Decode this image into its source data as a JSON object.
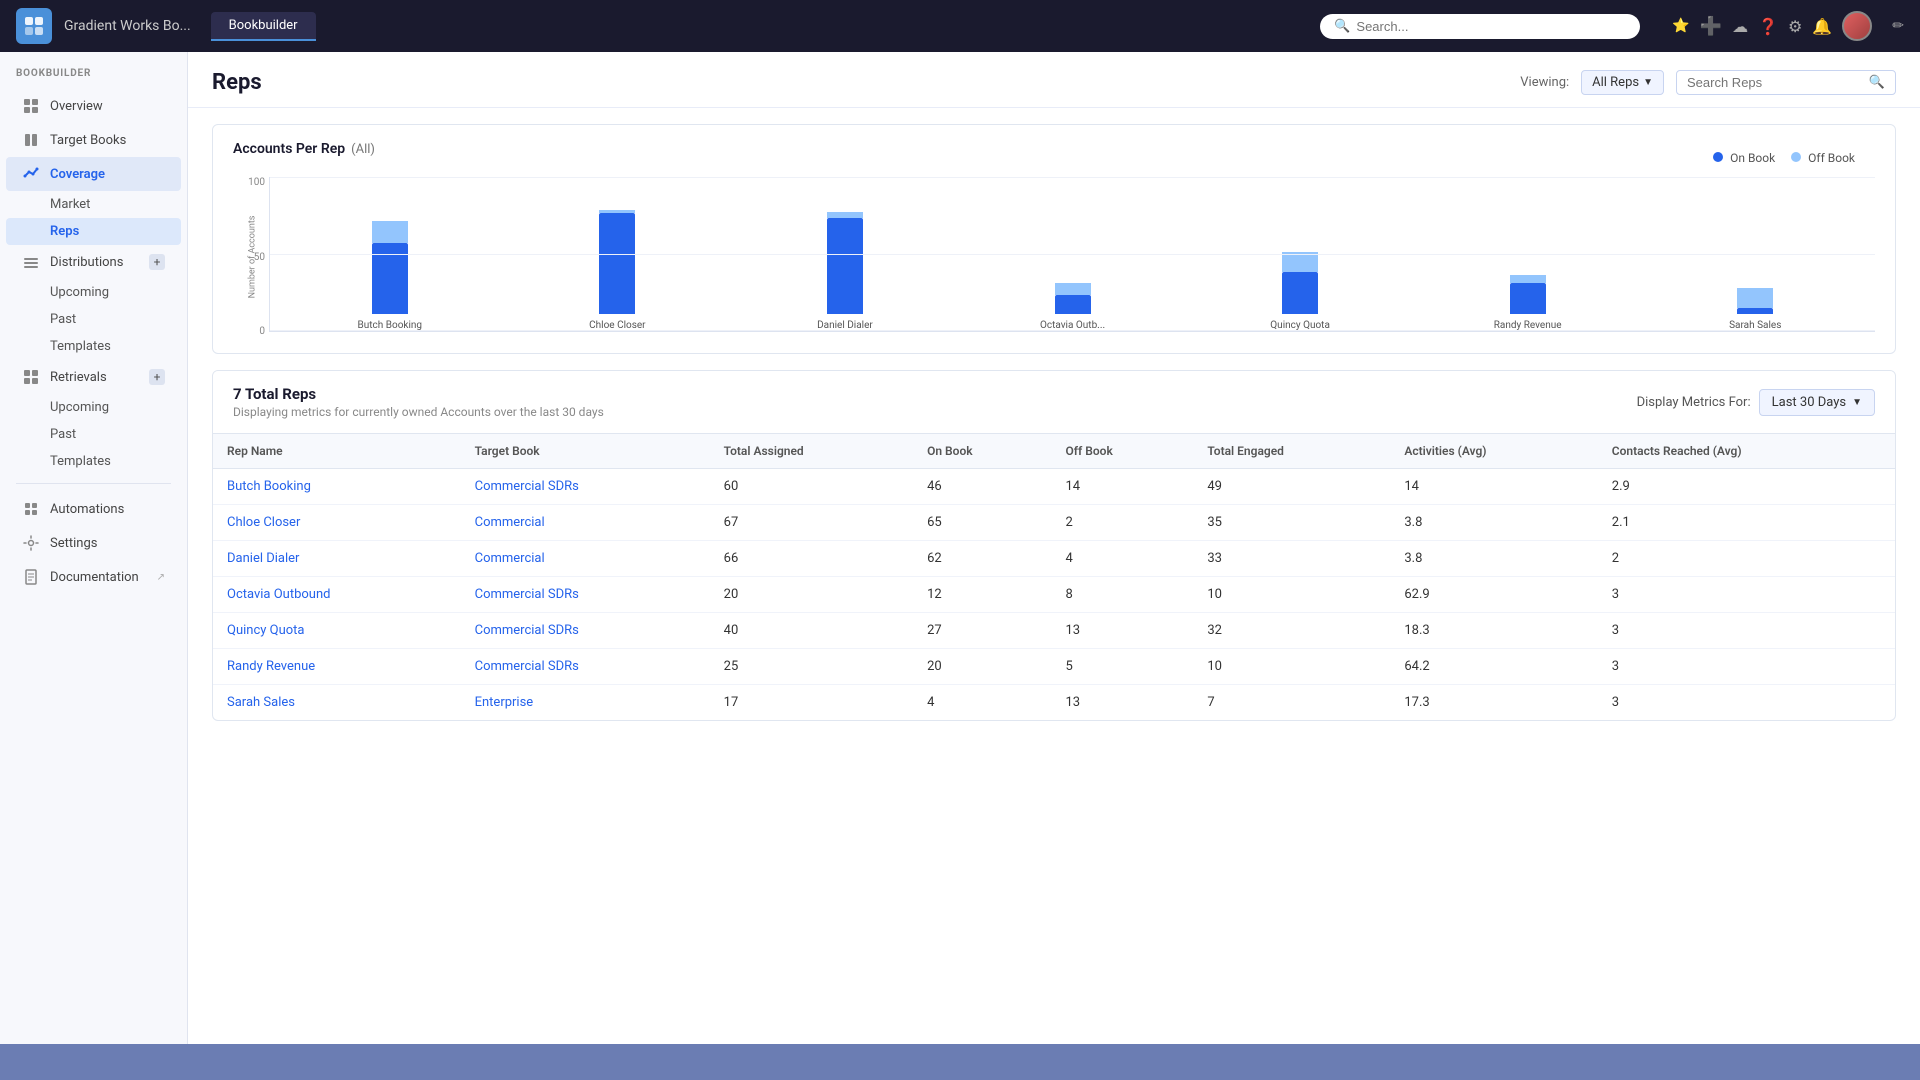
{
  "chrome": {
    "app_name": "Gradient Works Bo...",
    "tab_label": "Bookbuilder",
    "search_placeholder": "Search...",
    "icons": [
      "star-icon",
      "add-icon",
      "cloud-icon",
      "help-icon",
      "settings-icon",
      "notifications-icon"
    ]
  },
  "sidebar": {
    "section_title": "BOOKBUILDER",
    "items": [
      {
        "id": "overview",
        "label": "Overview",
        "icon": "overview-icon"
      },
      {
        "id": "target-books",
        "label": "Target Books",
        "icon": "books-icon"
      },
      {
        "id": "coverage",
        "label": "Coverage",
        "icon": "coverage-icon",
        "active": true,
        "children": [
          {
            "id": "market",
            "label": "Market"
          },
          {
            "id": "reps",
            "label": "Reps",
            "active": true
          }
        ]
      },
      {
        "id": "distributions",
        "label": "Distributions",
        "icon": "distributions-icon",
        "children": [
          {
            "id": "upcoming-dist",
            "label": "Upcoming"
          },
          {
            "id": "past-dist",
            "label": "Past"
          },
          {
            "id": "templates-dist",
            "label": "Templates"
          }
        ]
      },
      {
        "id": "retrievals",
        "label": "Retrievals",
        "icon": "retrievals-icon",
        "children": [
          {
            "id": "upcoming-ret",
            "label": "Upcoming"
          },
          {
            "id": "past-ret",
            "label": "Past"
          },
          {
            "id": "templates-ret",
            "label": "Templates"
          }
        ]
      },
      {
        "id": "automations",
        "label": "Automations",
        "icon": "automations-icon"
      },
      {
        "id": "settings",
        "label": "Settings",
        "icon": "settings-icon"
      },
      {
        "id": "documentation",
        "label": "Documentation",
        "icon": "documentation-icon"
      }
    ]
  },
  "page": {
    "title": "Reps",
    "viewing_label": "Viewing:",
    "viewing_value": "All Reps",
    "search_placeholder": "Search Reps"
  },
  "chart": {
    "title": "Accounts Per Rep",
    "subtitle": "(All)",
    "legend": {
      "on_book": "On Book",
      "off_book": "Off Book"
    },
    "y_axis_label": "Number of Accounts",
    "y_labels": [
      "100",
      "50",
      "0"
    ],
    "bars": [
      {
        "name": "Butch Booking",
        "on_book": 46,
        "off_book": 14,
        "total": 60
      },
      {
        "name": "Chloe Closer",
        "on_book": 65,
        "off_book": 2,
        "total": 67
      },
      {
        "name": "Daniel Dialer",
        "on_book": 62,
        "off_book": 4,
        "total": 66
      },
      {
        "name": "Octavia Outb...",
        "on_book": 12,
        "off_book": 8,
        "total": 20
      },
      {
        "name": "Quincy Quota",
        "on_book": 27,
        "off_book": 13,
        "total": 40
      },
      {
        "name": "Randy Revenue",
        "on_book": 20,
        "off_book": 5,
        "total": 25
      },
      {
        "name": "Sarah Sales",
        "on_book": 4,
        "off_book": 13,
        "total": 17
      }
    ],
    "max_value": 100
  },
  "table": {
    "total_label": "7 Total Reps",
    "subtitle": "Displaying metrics for currently owned Accounts over the last 30 days",
    "display_metrics_label": "Display Metrics For:",
    "display_metrics_value": "Last 30 Days",
    "columns": [
      "Rep Name",
      "Target Book",
      "Total Assigned",
      "On Book",
      "Off Book",
      "Total Engaged",
      "Activities (Avg)",
      "Contacts Reached (Avg)"
    ],
    "rows": [
      {
        "name": "Butch Booking",
        "target_book": "Commercial SDRs",
        "total_assigned": "60",
        "on_book": "46",
        "off_book": "14",
        "total_engaged": "49",
        "activities_avg": "14",
        "contacts_reached": "2.9"
      },
      {
        "name": "Chloe Closer",
        "target_book": "Commercial",
        "total_assigned": "67",
        "on_book": "65",
        "off_book": "2",
        "total_engaged": "35",
        "activities_avg": "3.8",
        "contacts_reached": "2.1"
      },
      {
        "name": "Daniel Dialer",
        "target_book": "Commercial",
        "total_assigned": "66",
        "on_book": "62",
        "off_book": "4",
        "total_engaged": "33",
        "activities_avg": "3.8",
        "contacts_reached": "2"
      },
      {
        "name": "Octavia Outbound",
        "target_book": "Commercial SDRs",
        "total_assigned": "20",
        "on_book": "12",
        "off_book": "8",
        "total_engaged": "10",
        "activities_avg": "62.9",
        "contacts_reached": "3"
      },
      {
        "name": "Quincy Quota",
        "target_book": "Commercial SDRs",
        "total_assigned": "40",
        "on_book": "27",
        "off_book": "13",
        "total_engaged": "32",
        "activities_avg": "18.3",
        "contacts_reached": "3"
      },
      {
        "name": "Randy Revenue",
        "target_book": "Commercial SDRs",
        "total_assigned": "25",
        "on_book": "20",
        "off_book": "5",
        "total_engaged": "10",
        "activities_avg": "64.2",
        "contacts_reached": "3"
      },
      {
        "name": "Sarah Sales",
        "target_book": "Enterprise",
        "total_assigned": "17",
        "on_book": "4",
        "off_book": "13",
        "total_engaged": "7",
        "activities_avg": "17.3",
        "contacts_reached": "3"
      }
    ]
  },
  "colors": {
    "on_book": "#2563eb",
    "off_book": "#93c5fd",
    "link": "#2563eb",
    "sidebar_active": "#2563eb"
  }
}
